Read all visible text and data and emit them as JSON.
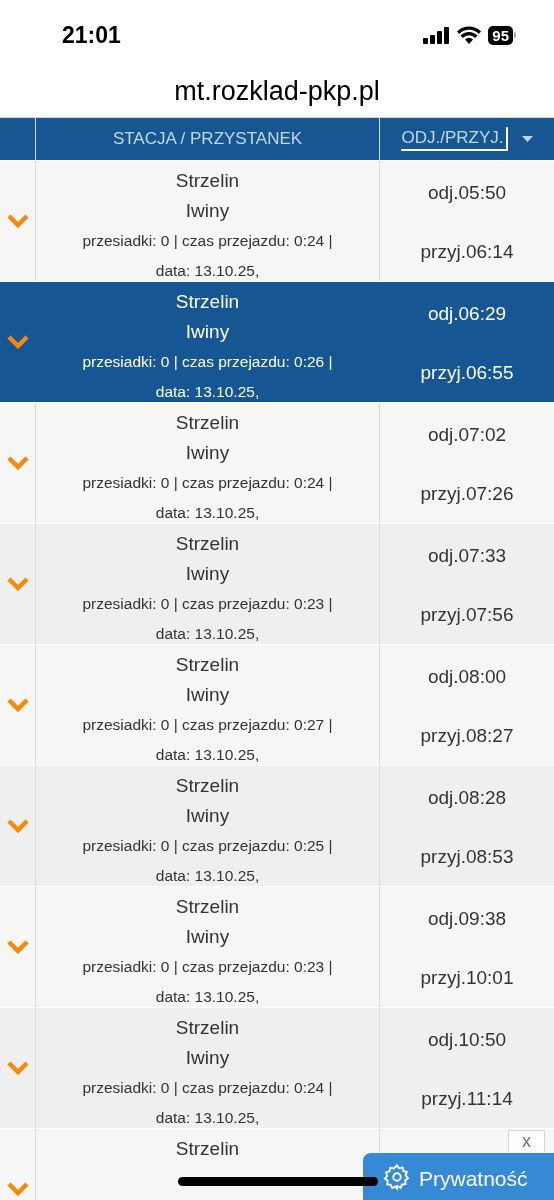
{
  "status_bar": {
    "time": "21:01",
    "battery": "95"
  },
  "address_bar": {
    "url": "mt.rozklad-pkp.pl"
  },
  "table": {
    "columns": [
      {
        "label": "STACJA / PRZYSTANEK"
      },
      {
        "label": "ODJ./PRZYJ."
      }
    ],
    "rows": [
      {
        "selected": false,
        "from": "Strzelin",
        "to": "Iwiny",
        "details": "przesiadki: 0 | czas przejazdu: 0:24 | data: 13.10.25,",
        "departure": "odj.05:50",
        "arrival": "przyj.06:14"
      },
      {
        "selected": true,
        "from": "Strzelin",
        "to": "Iwiny",
        "details": "przesiadki: 0 | czas przejazdu: 0:26 | data: 13.10.25,",
        "departure": "odj.06:29",
        "arrival": "przyj.06:55"
      },
      {
        "selected": false,
        "from": "Strzelin",
        "to": "Iwiny",
        "details": "przesiadki: 0 | czas przejazdu: 0:24 | data: 13.10.25,",
        "departure": "odj.07:02",
        "arrival": "przyj.07:26"
      },
      {
        "selected": false,
        "from": "Strzelin",
        "to": "Iwiny",
        "details": "przesiadki: 0 | czas przejazdu: 0:23 | data: 13.10.25,",
        "departure": "odj.07:33",
        "arrival": "przyj.07:56"
      },
      {
        "selected": false,
        "from": "Strzelin",
        "to": "Iwiny",
        "details": "przesiadki: 0 | czas przejazdu: 0:27 | data: 13.10.25,",
        "departure": "odj.08:00",
        "arrival": "przyj.08:27"
      },
      {
        "selected": false,
        "from": "Strzelin",
        "to": "Iwiny",
        "details": "przesiadki: 0 | czas przejazdu: 0:25 | data: 13.10.25,",
        "departure": "odj.08:28",
        "arrival": "przyj.08:53"
      },
      {
        "selected": false,
        "from": "Strzelin",
        "to": "Iwiny",
        "details": "przesiadki: 0 | czas przejazdu: 0:23 | data: 13.10.25,",
        "departure": "odj.09:38",
        "arrival": "przyj.10:01"
      },
      {
        "selected": false,
        "from": "Strzelin",
        "to": "Iwiny",
        "details": "przesiadki: 0 | czas przejazdu: 0:24 | data: 13.10.25,",
        "departure": "odj.10:50",
        "arrival": "przyj.11:14"
      },
      {
        "selected": false,
        "from": "Strzelin"
      }
    ]
  },
  "close_button": {
    "label": "x"
  },
  "privacy_button": {
    "label": "Prywatność"
  }
}
